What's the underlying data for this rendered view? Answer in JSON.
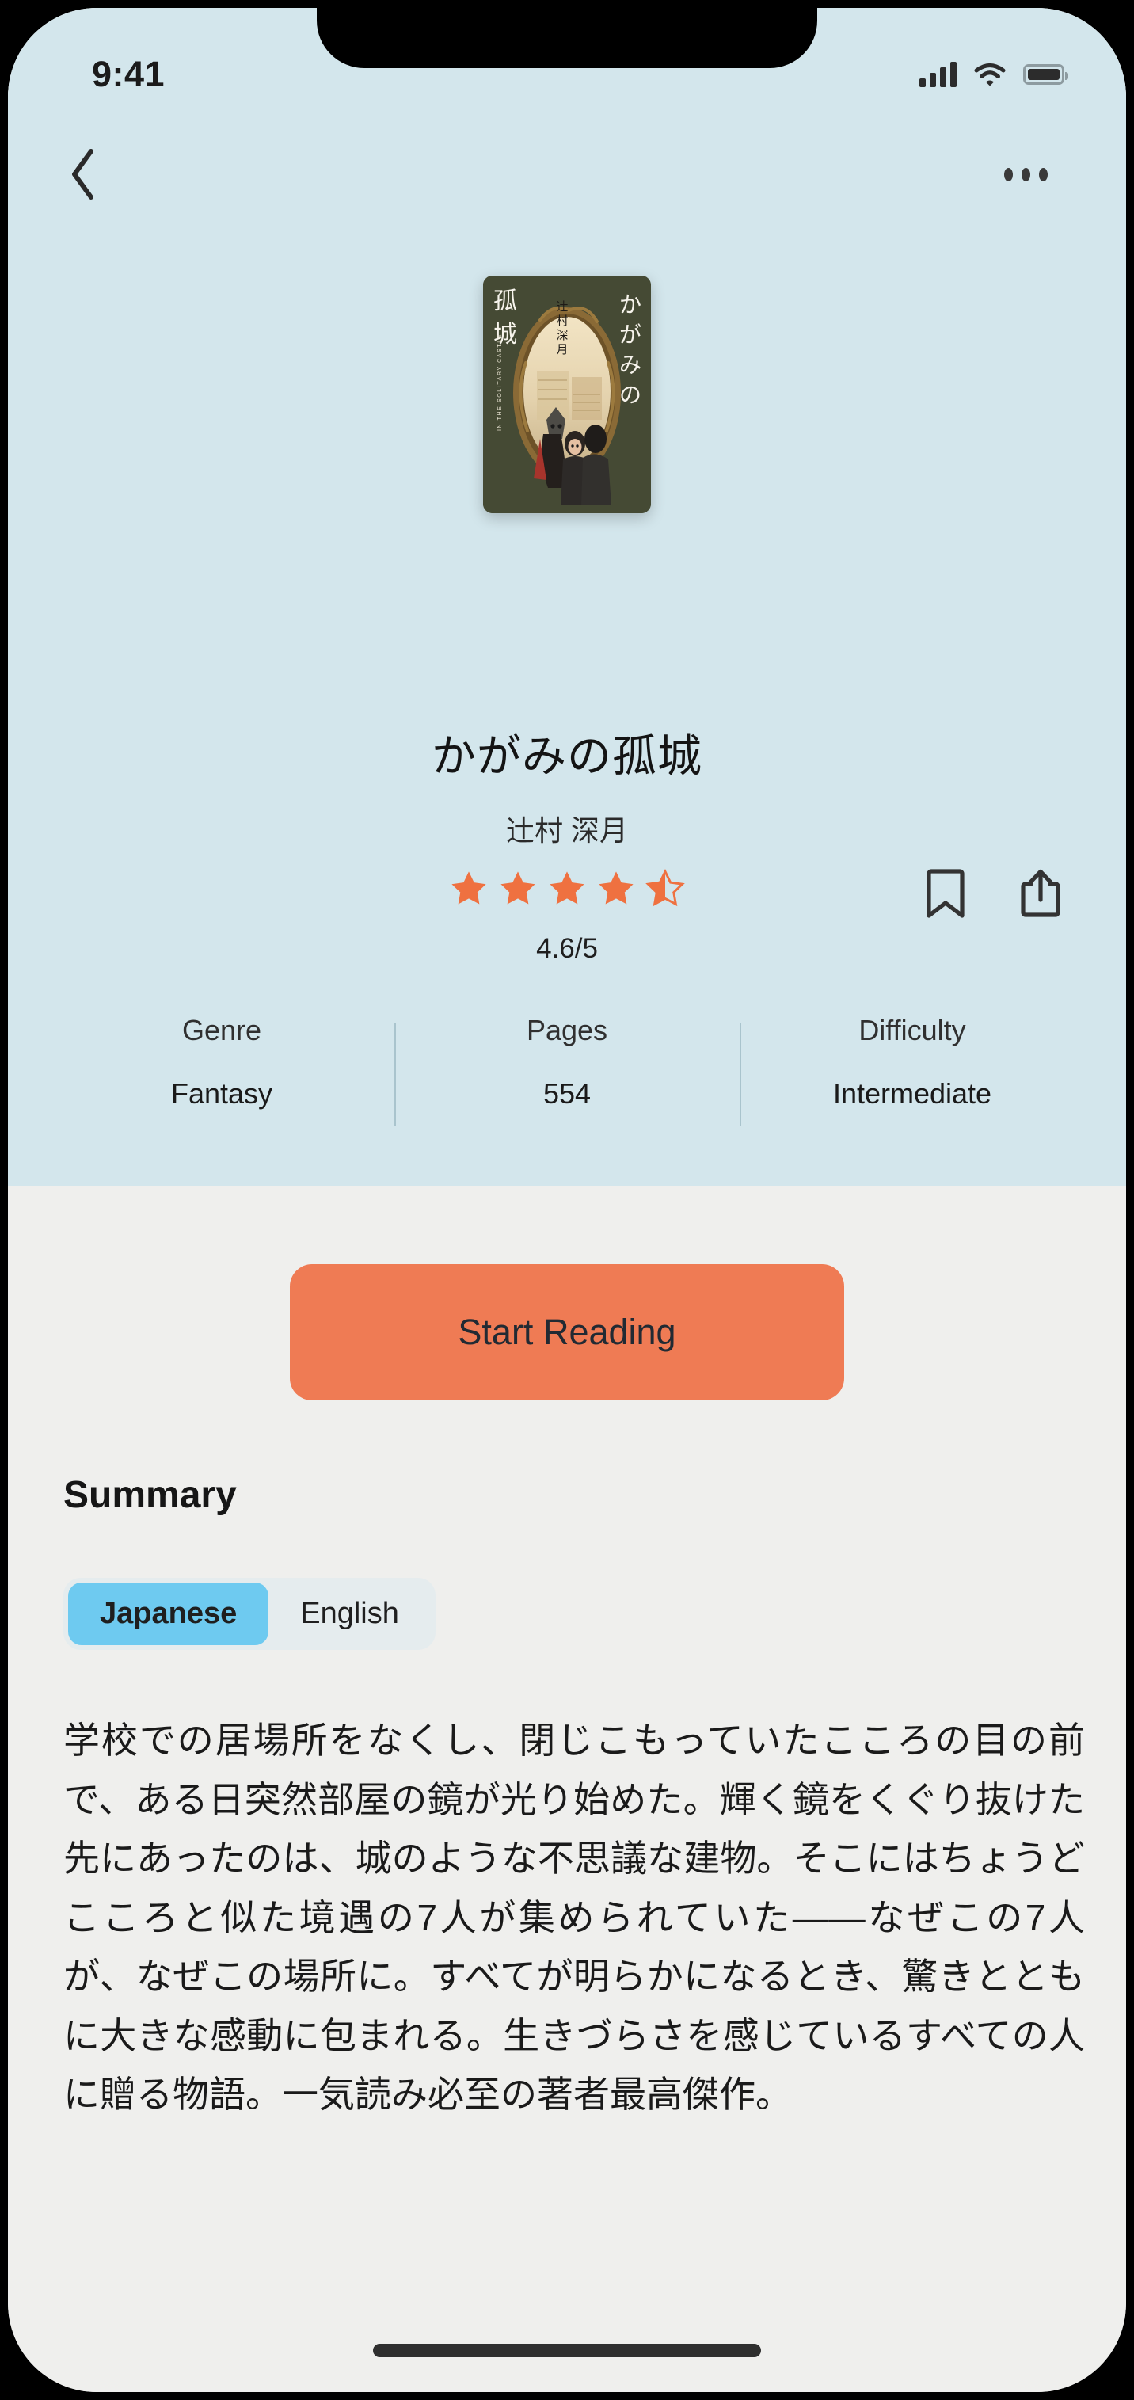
{
  "status_bar": {
    "time": "9:41",
    "signal_icon": "cellular-signal-icon",
    "wifi_icon": "wifi-icon",
    "battery_icon": "battery-full-icon"
  },
  "navbar": {
    "back_icon": "back-chevron-icon",
    "more_icon": "more-options-icon"
  },
  "book": {
    "cover_alt": "かがみの孤城 book cover",
    "cover_title_vertical": "かがみの孤城",
    "cover_author_vertical": "辻村深月",
    "cover_subtitle_romaji": "IN THE SOLITARY CASTLE",
    "title": "かがみの孤城",
    "author": "辻村 深月",
    "rating_value": "4.6/5",
    "rating_stars": 4.6,
    "stars_total": 5,
    "star_color": "#ef7140"
  },
  "actions": {
    "bookmark_icon": "bookmark-icon",
    "share_icon": "share-icon"
  },
  "stats": [
    {
      "label": "Genre",
      "value": "Fantasy"
    },
    {
      "label": "Pages",
      "value": "554"
    },
    {
      "label": "Difficulty",
      "value": "Intermediate"
    }
  ],
  "primary_action": {
    "label": "Start Reading",
    "color": "#ef7b54"
  },
  "summary": {
    "heading": "Summary",
    "tabs": [
      {
        "label": "Japanese",
        "active": true
      },
      {
        "label": "English",
        "active": false
      }
    ],
    "active_tab_color": "#6ecaf0",
    "body": "学校での居場所をなくし、閉じこもっていたこころの目の前で、ある日突然部屋の鏡が光り始めた。輝く鏡をくぐり抜けた先にあったのは、城のような不思議な建物。そこにはちょうどこころと似た境遇の7人が集められていた——なぜこの7人が、なぜこの場所に。すべてが明らかになるとき、驚きとともに大きな感動に包まれる。生きづらさを感じているすべての人に贈る物語。一気読み必至の著者最高傑作。"
  },
  "theme": {
    "hero_background": "#d3e6ec",
    "body_background": "#efefed"
  }
}
